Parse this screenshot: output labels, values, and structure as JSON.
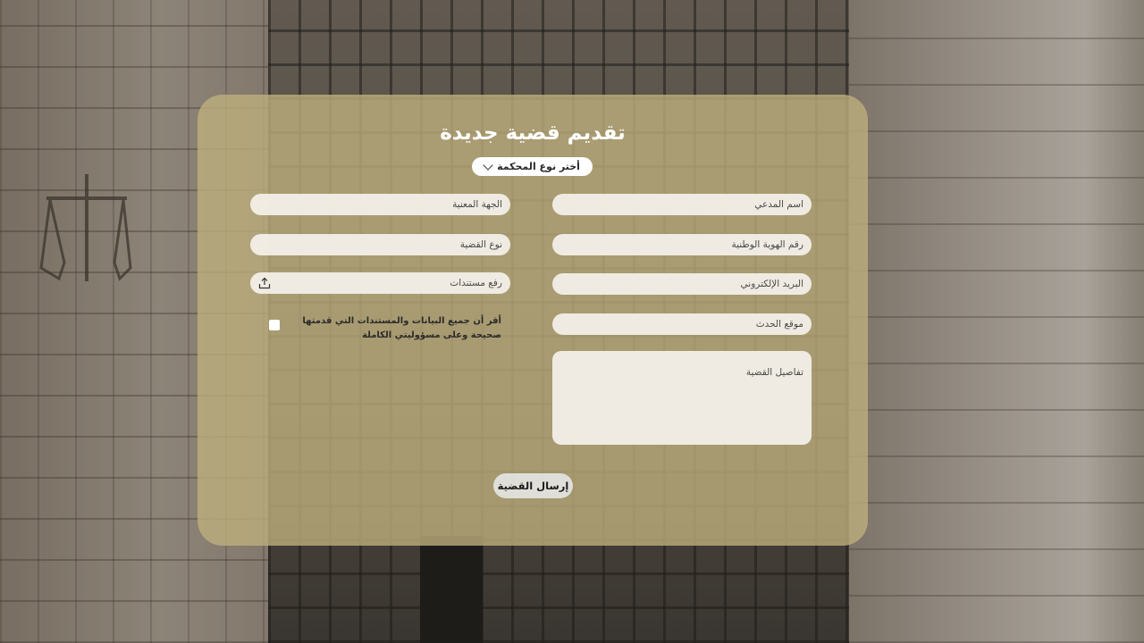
{
  "form": {
    "title": "تقديم قضية جديدة",
    "court_select": {
      "selected": "أختر نوع المحكمة",
      "icon": "chevron-down-icon"
    },
    "fields": {
      "plaintiff_name": "اسم المدعي",
      "national_id": "رقم الهوية الوطنية",
      "email": "البريد الإلكتروني",
      "incident_location": "موقع الحدث",
      "case_details": "تفاصيل القضية",
      "concerned_party": "الجهة المعنية",
      "case_type": "نوع القضية"
    },
    "upload": {
      "label": "رفع مستندات",
      "icon": "upload-icon"
    },
    "consent": {
      "text": "أقر أن جميع البيانات والمستندات التي قدمتها صحيحة وعلى مسؤوليتي الكاملة",
      "checked": false
    },
    "submit_label": "إرسال القضية"
  },
  "colors": {
    "card_overlay": "#BEAF7D",
    "field_bg": "#F5F2EC",
    "title": "#FFFFFF"
  }
}
